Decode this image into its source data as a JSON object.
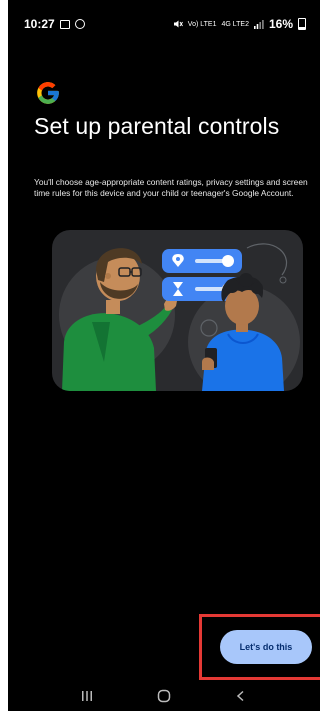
{
  "status_bar": {
    "time": "10:27",
    "icons_left": [
      "image-icon",
      "whatsapp-icon"
    ],
    "icons_right": [
      "mute-icon",
      "volte-icon",
      "lte-icon",
      "signal-icon"
    ],
    "volte_label": "Vo) LTE1",
    "lte_label": "4G LTE2",
    "battery_percent": "16%"
  },
  "header": {
    "logo": "google-g-icon",
    "title": "Set up parental controls"
  },
  "main": {
    "description": "You'll choose age-appropriate content ratings, privacy settings and screen time rules for this device and your child or teenager's Google Account."
  },
  "illustration": {
    "alt_icons": [
      "location-pin-icon",
      "hourglass-icon",
      "toggle-switch-icon"
    ]
  },
  "actions": {
    "primary_label": "Let's do this"
  },
  "nav_bar": {
    "buttons": [
      "recents-icon",
      "home-icon",
      "back-icon"
    ]
  },
  "colors": {
    "background": "#000000",
    "button_bg": "#a8c7fa",
    "button_text": "#062e6f",
    "highlight": "#e53935"
  }
}
